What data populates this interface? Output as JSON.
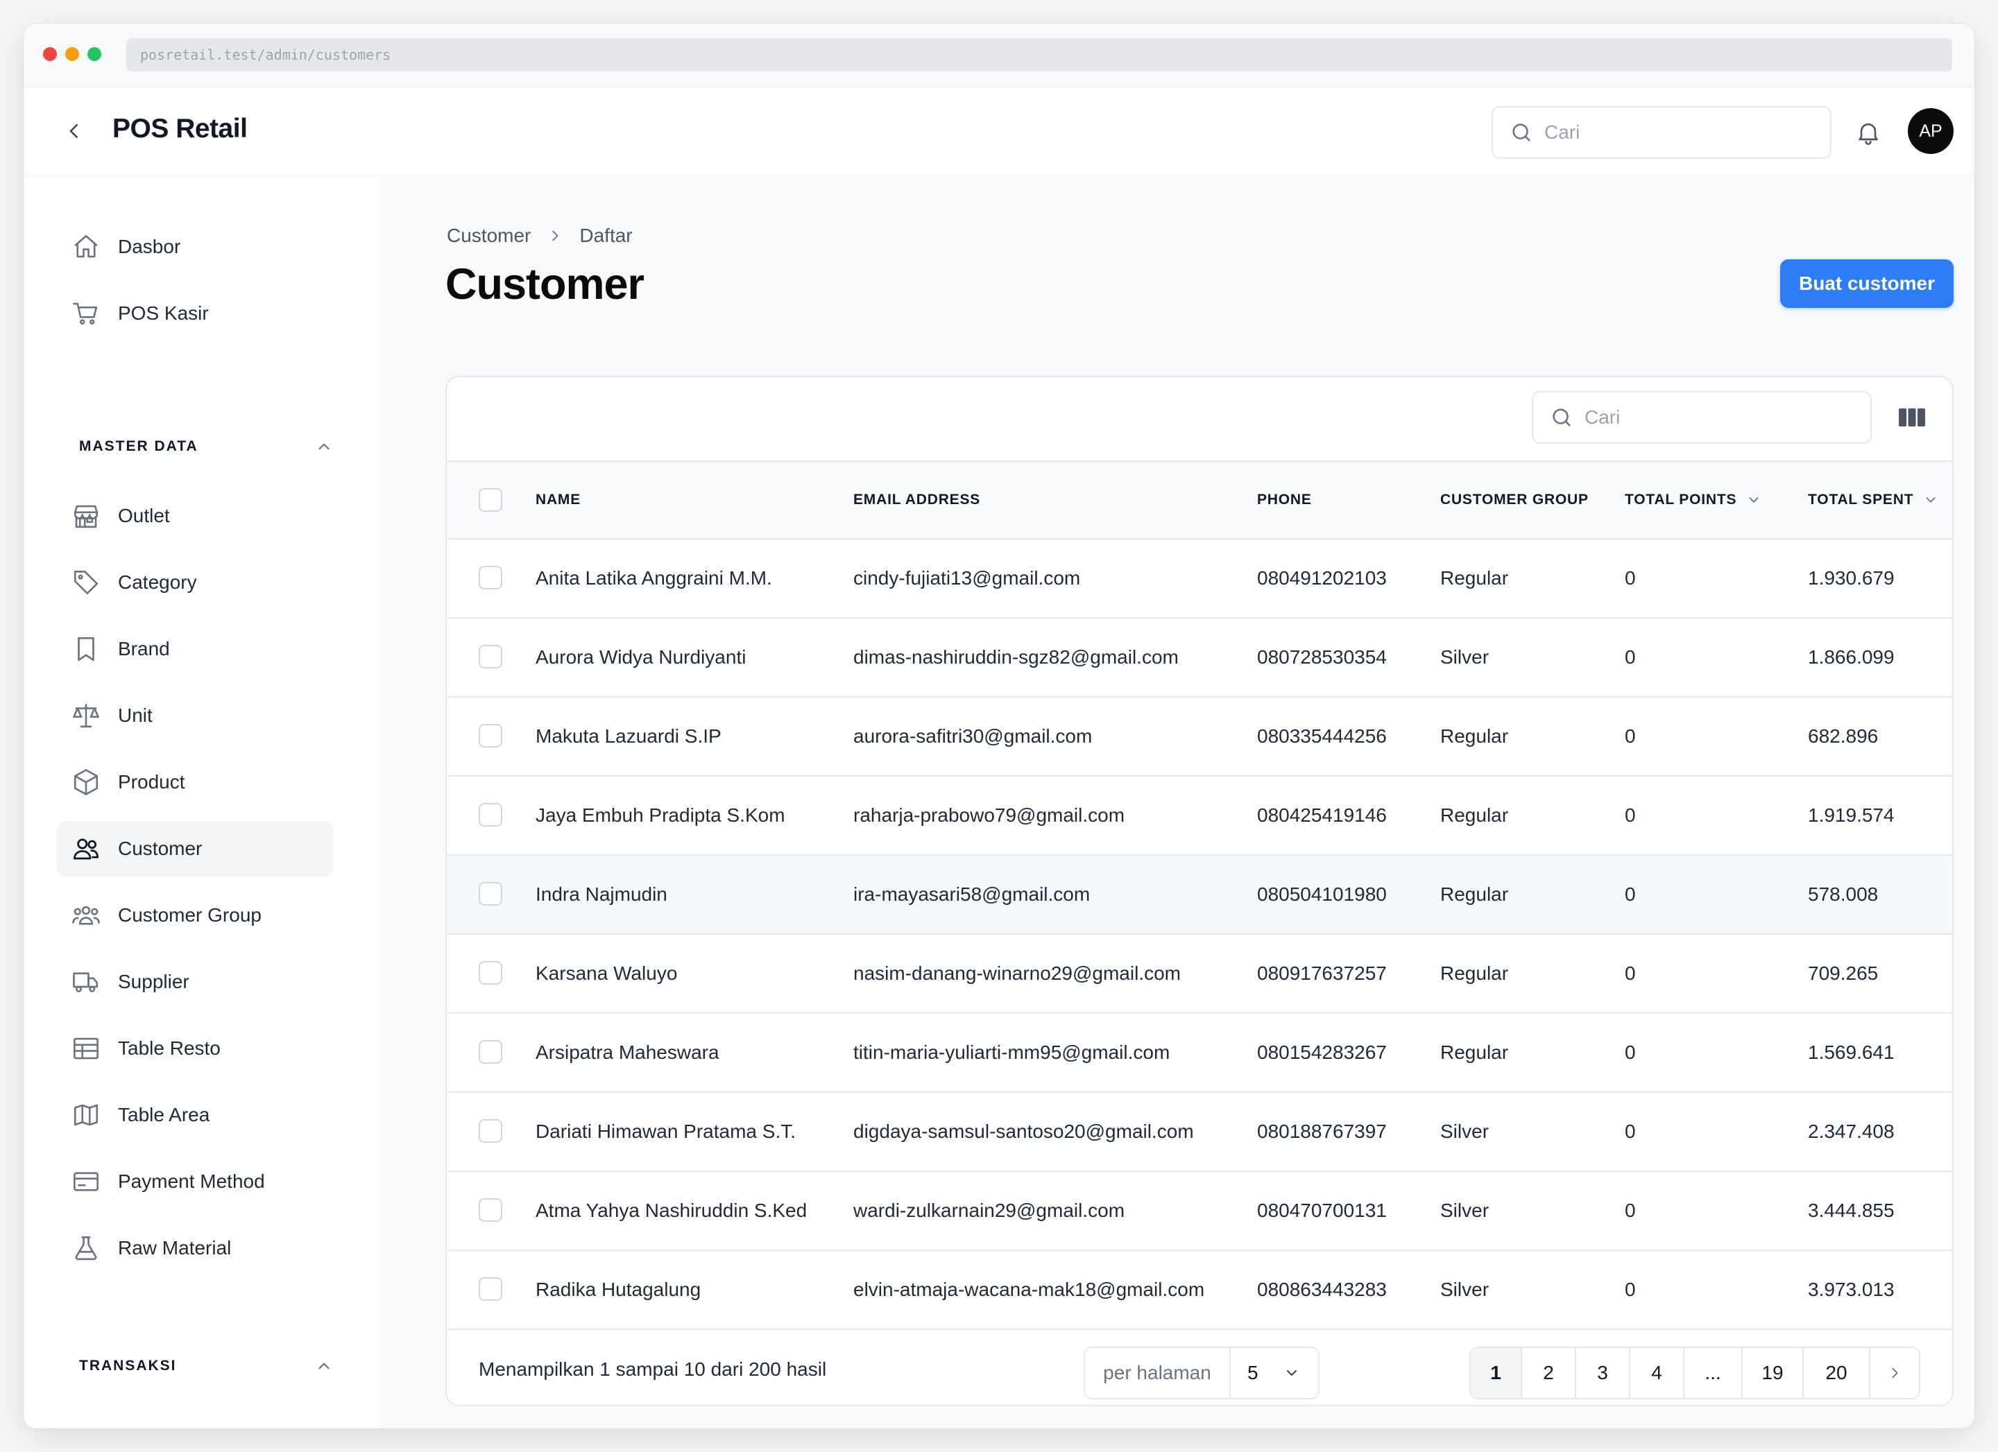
{
  "browser": {
    "url": "posretail.test/admin/customers"
  },
  "topbar": {
    "app_title": "POS Retail",
    "search_placeholder": "Cari",
    "avatar_initials": "AP"
  },
  "sidebar": {
    "top_items": [
      {
        "label": "Dasbor",
        "icon": "home-icon"
      },
      {
        "label": "POS Kasir",
        "icon": "cart-icon"
      }
    ],
    "master_heading": "MASTER DATA",
    "master_items": [
      {
        "label": "Outlet",
        "icon": "store-icon"
      },
      {
        "label": "Category",
        "icon": "tag-icon"
      },
      {
        "label": "Brand",
        "icon": "bookmark-icon"
      },
      {
        "label": "Unit",
        "icon": "scale-icon"
      },
      {
        "label": "Product",
        "icon": "cube-icon"
      },
      {
        "label": "Customer",
        "icon": "users-icon",
        "active": true
      },
      {
        "label": "Customer Group",
        "icon": "user-group-icon"
      },
      {
        "label": "Supplier",
        "icon": "truck-icon"
      },
      {
        "label": "Table Resto",
        "icon": "table-icon"
      },
      {
        "label": "Table Area",
        "icon": "map-icon"
      },
      {
        "label": "Payment Method",
        "icon": "credit-card-icon"
      },
      {
        "label": "Raw Material",
        "icon": "beaker-icon"
      }
    ],
    "transaksi_heading": "TRANSAKSI"
  },
  "page": {
    "breadcrumb": [
      "Customer",
      "Daftar"
    ],
    "title": "Customer",
    "create_button": "Buat customer"
  },
  "table": {
    "search_placeholder": "Cari",
    "columns": [
      "NAME",
      "EMAIL ADDRESS",
      "PHONE",
      "CUSTOMER GROUP",
      "TOTAL POINTS",
      "TOTAL SPENT"
    ],
    "rows": [
      {
        "name": "Anita Latika Anggraini M.M.",
        "email": "cindy-fujiati13@gmail.com",
        "phone": "080491202103",
        "group": "Regular",
        "points": "0",
        "spent": "1.930.679"
      },
      {
        "name": "Aurora Widya Nurdiyanti",
        "email": "dimas-nashiruddin-sgz82@gmail.com",
        "phone": "080728530354",
        "group": "Silver",
        "points": "0",
        "spent": "1.866.099"
      },
      {
        "name": "Makuta Lazuardi S.IP",
        "email": "aurora-safitri30@gmail.com",
        "phone": "080335444256",
        "group": "Regular",
        "points": "0",
        "spent": "682.896"
      },
      {
        "name": "Jaya Embuh Pradipta S.Kom",
        "email": "raharja-prabowo79@gmail.com",
        "phone": "080425419146",
        "group": "Regular",
        "points": "0",
        "spent": "1.919.574"
      },
      {
        "name": "Indra Najmudin",
        "email": "ira-mayasari58@gmail.com",
        "phone": "080504101980",
        "group": "Regular",
        "points": "0",
        "spent": "578.008"
      },
      {
        "name": "Karsana Waluyo",
        "email": "nasim-danang-winarno29@gmail.com",
        "phone": "080917637257",
        "group": "Regular",
        "points": "0",
        "spent": "709.265"
      },
      {
        "name": "Arsipatra Maheswara",
        "email": "titin-maria-yuliarti-mm95@gmail.com",
        "phone": "080154283267",
        "group": "Regular",
        "points": "0",
        "spent": "1.569.641"
      },
      {
        "name": "Dariati Himawan Pratama S.T.",
        "email": "digdaya-samsul-santoso20@gmail.com",
        "phone": "080188767397",
        "group": "Silver",
        "points": "0",
        "spent": "2.347.408"
      },
      {
        "name": "Atma Yahya Nashiruddin S.Ked",
        "email": "wardi-zulkarnain29@gmail.com",
        "phone": "080470700131",
        "group": "Silver",
        "points": "0",
        "spent": "3.444.855"
      },
      {
        "name": "Radika Hutagalung",
        "email": "elvin-atmaja-wacana-mak18@gmail.com",
        "phone": "080863443283",
        "group": "Silver",
        "points": "0",
        "spent": "3.973.013"
      }
    ],
    "summary": "Menampilkan 1 sampai 10 dari 200 hasil",
    "per_page_label": "per halaman",
    "per_page_value": "5",
    "pages": [
      "1",
      "2",
      "3",
      "4",
      "...",
      "19",
      "20"
    ],
    "current_page": "1"
  }
}
